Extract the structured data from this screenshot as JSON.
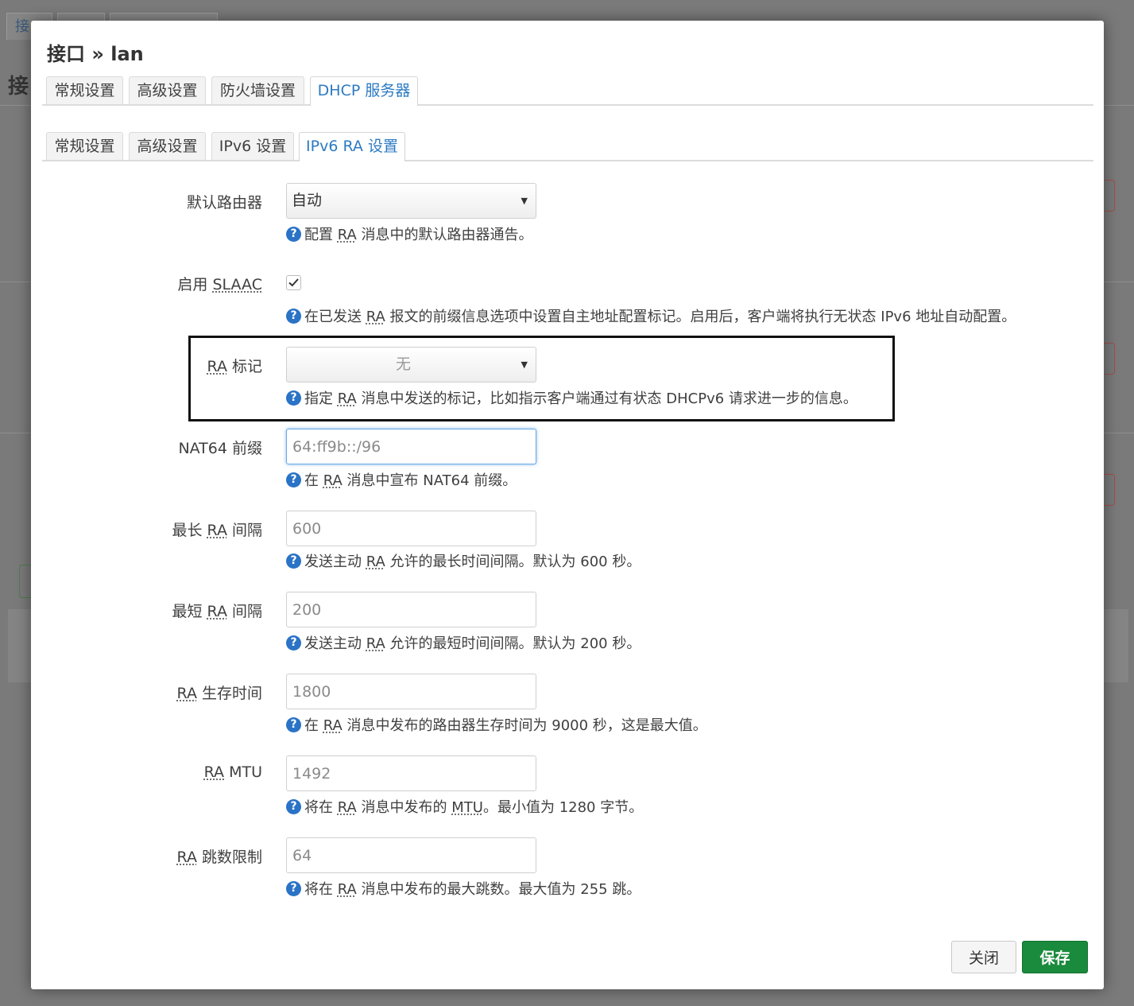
{
  "background": {
    "tab_fragment": "接",
    "heading_fragment": "接"
  },
  "modal": {
    "title": "接口 » lan",
    "tabs": [
      {
        "label": "常规设置"
      },
      {
        "label": "高级设置"
      },
      {
        "label": "防火墙设置"
      },
      {
        "label": "DHCP 服务器"
      }
    ],
    "active_tab": "DHCP 服务器",
    "subtabs": [
      {
        "label": "常规设置"
      },
      {
        "label": "高级设置"
      },
      {
        "label": "IPv6 设置"
      },
      {
        "label": "IPv6 RA 设置"
      }
    ],
    "active_subtab": "IPv6 RA 设置"
  },
  "form": {
    "default_router": {
      "label": "默认路由器",
      "value": "自动",
      "help_a": "配置 ",
      "help_abbr": "RA",
      "help_b": " 消息中的默认路由器通告。"
    },
    "slaac": {
      "label_a": "启用 ",
      "label_abbr": "SLAAC",
      "checked": true,
      "help_a": "在已发送 ",
      "help_abbr": "RA",
      "help_b": " 报文的前缀信息选项中设置自主地址配置标记。启用后，客户端将执行无状态 IPv6 地址自动配置。"
    },
    "ra_flags": {
      "label_abbr": "RA",
      "label_b": " 标记",
      "value": "无",
      "help_a": "指定 ",
      "help_abbr": "RA",
      "help_b": " 消息中发送的标记，比如指示客户端通过有状态 DHCPv6 请求进一步的信息。"
    },
    "nat64": {
      "label": "NAT64 前缀",
      "placeholder": "64:ff9b::/96",
      "help_a": "在 ",
      "help_abbr": "RA",
      "help_b": " 消息中宣布 NAT64 前缀。"
    },
    "max_interval": {
      "label_a": "最长 ",
      "label_abbr": "RA",
      "label_b": " 间隔",
      "placeholder": "600",
      "help_a": "发送主动 ",
      "help_abbr": "RA",
      "help_b": " 允许的最长时间间隔。默认为 600 秒。"
    },
    "min_interval": {
      "label_a": "最短 ",
      "label_abbr": "RA",
      "label_b": " 间隔",
      "placeholder": "200",
      "help_a": "发送主动 ",
      "help_abbr": "RA",
      "help_b": " 允许的最短时间间隔。默认为 200 秒。"
    },
    "lifetime": {
      "label_abbr": "RA",
      "label_b": " 生存时间",
      "placeholder": "1800",
      "help_a": "在 ",
      "help_abbr": "RA",
      "help_b": " 消息中发布的路由器生存时间为 9000 秒，这是最大值。"
    },
    "mtu": {
      "label_abbr": "RA",
      "label_b": " MTU",
      "placeholder": "1492",
      "help_a": "将在 ",
      "help_abbr": "RA",
      "help_b": " 消息中发布的 ",
      "help_abbr2": "MTU",
      "help_c": "。最小值为 1280 字节。"
    },
    "hop_limit": {
      "label_abbr": "RA",
      "label_b": " 跳数限制",
      "placeholder": "64",
      "help_a": "将在 ",
      "help_abbr": "RA",
      "help_b": " 消息中发布的最大跳数。最大值为 255 跳。"
    }
  },
  "buttons": {
    "close": "关闭",
    "save": "保存"
  },
  "colors": {
    "accent": "#2c7ac2",
    "save": "#1a8a3c",
    "help_icon": "#2a73c6"
  }
}
